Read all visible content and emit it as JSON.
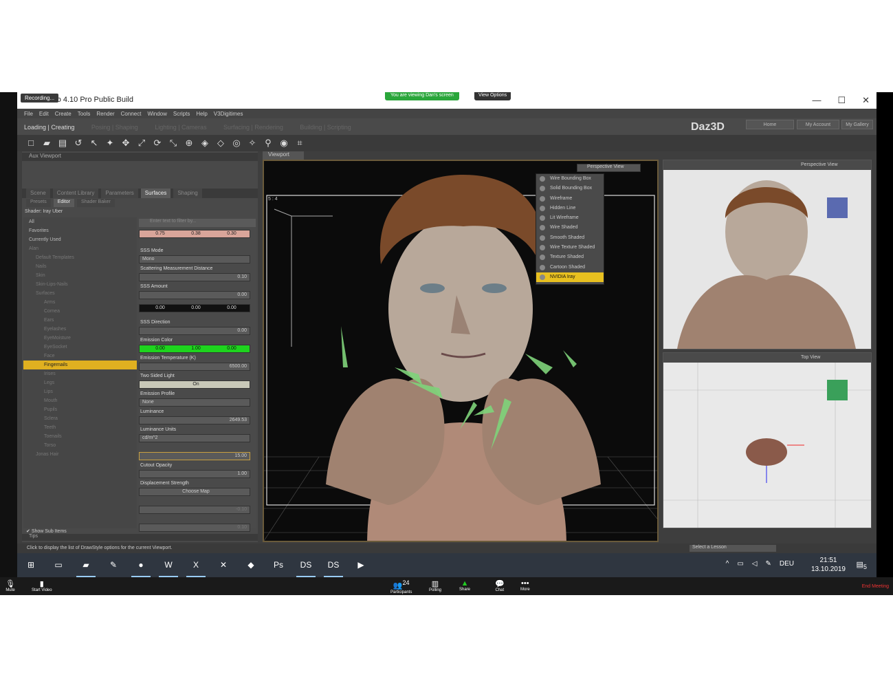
{
  "window": {
    "title": "Daz Studio 4.10 Pro Public Build",
    "recording": "Recording...",
    "share_banner": "You are viewing Dan's screen",
    "view_options": "View Options"
  },
  "menu": [
    "File",
    "Edit",
    "Create",
    "Tools",
    "Render",
    "Connect",
    "Window",
    "Scripts",
    "Help",
    "V3Digitimes"
  ],
  "room_tabs": [
    "Loading | Creating",
    "Posing | Shaping",
    "Lighting | Cameras",
    "Surfacing | Rendering",
    "Building | Scripting"
  ],
  "brand": "Daz3D",
  "top_buttons": [
    "Home",
    "My Account",
    "My Gallery"
  ],
  "aux_viewport": "Aux Viewport",
  "panel_tabs": [
    "Scene",
    "Content Library",
    "Parameters",
    "Surfaces",
    "Shaping"
  ],
  "sub_tabs": [
    "Presets",
    "Editor",
    "Shader Baker"
  ],
  "shader_label": "Shader: Iray Uber",
  "tree": [
    {
      "label": "All",
      "type": "top"
    },
    {
      "label": "Favorites",
      "type": "top"
    },
    {
      "label": "Currently Used",
      "type": "top"
    },
    {
      "label": "Alan",
      "type": "dim"
    },
    {
      "label": "Default Templates",
      "type": "dim"
    },
    {
      "label": "Nails",
      "type": "dim"
    },
    {
      "label": "Skin",
      "type": "dim"
    },
    {
      "label": "Skin-Lips-Nails",
      "type": "dim"
    },
    {
      "label": "Surfaces",
      "type": "dim"
    },
    {
      "label": "Arms",
      "type": "dim"
    },
    {
      "label": "Cornea",
      "type": "dim"
    },
    {
      "label": "Ears",
      "type": "dim"
    },
    {
      "label": "Eyelashes",
      "type": "dim"
    },
    {
      "label": "EyeMoisture",
      "type": "dim"
    },
    {
      "label": "EyeSocket",
      "type": "dim"
    },
    {
      "label": "Face",
      "type": "dim"
    },
    {
      "label": "Fingernails",
      "type": "sel"
    },
    {
      "label": "Irises",
      "type": "dim"
    },
    {
      "label": "Legs",
      "type": "dim"
    },
    {
      "label": "Lips",
      "type": "dim"
    },
    {
      "label": "Mouth",
      "type": "dim"
    },
    {
      "label": "Pupils",
      "type": "dim"
    },
    {
      "label": "Sclera",
      "type": "dim"
    },
    {
      "label": "Teeth",
      "type": "dim"
    },
    {
      "label": "Toenails",
      "type": "dim"
    },
    {
      "label": "Torso",
      "type": "dim"
    },
    {
      "label": "Jonas Hair",
      "type": "dim"
    }
  ],
  "filter_placeholder": "Enter text to filter by...",
  "props": {
    "color_vals": [
      "0.75",
      "0.38",
      "0.30"
    ],
    "sss_mode_label": "SSS Mode",
    "sss_mode_val": "Mono",
    "scatter_label": "Scattering Measurement Distance",
    "scatter_val": "0.10",
    "sss_amount_label": "SSS Amount",
    "sss_amount_val": "0.00",
    "black_vals": [
      "0.00",
      "0.00",
      "0.00"
    ],
    "sss_dir_label": "SSS Direction",
    "sss_dir_val": "0.00",
    "emis_color_label": "Emission Color",
    "emis_vals": [
      "0.00",
      "1.00",
      "0.00"
    ],
    "emis_temp_label": "Emission Temperature (K)",
    "emis_temp_val": "6500.00",
    "two_sided_label": "Two Sided Light",
    "two_sided_val": "On",
    "emis_profile_label": "Emission Profile",
    "emis_profile_val": "None",
    "lum_label": "Luminance",
    "lum_val": "2649.53",
    "lum_units_label": "Luminance Units",
    "lum_units_val": "cd/m^2",
    "lum_eff_val": "15.00",
    "cutout_label": "Cutout Opacity",
    "cutout_val": "1.00",
    "disp_label": "Displacement Strength",
    "disp_map": "Choose Map",
    "min_disp_val": "-0.10",
    "max_disp_val": "0.10"
  },
  "show_sub_items": "Show Sub Items",
  "tips": "Tips",
  "viewport_tab": "Viewport",
  "aspect": "5 : 4",
  "perspective_btn": "Perspective View",
  "drawstyles": [
    "Wire Bounding Box",
    "Solid Bounding Box",
    "Wireframe",
    "Hidden Line",
    "Lit Wireframe",
    "Wire Shaded",
    "Smooth Shaded",
    "Wire Texture Shaded",
    "Texture Shaded",
    "Cartoon Shaded",
    "NVIDIA Iray"
  ],
  "right_top_view": "Perspective View",
  "right_bottom_view": "Top View",
  "status": "Click to display the list of DrawStyle options for the current Viewport.",
  "lesson": "Select a Lesson",
  "taskbar": {
    "lang": "DEU",
    "time": "21:51",
    "date": "13.10.2019",
    "notif": "5"
  },
  "zoom": {
    "mute": "Mute",
    "video": "Start Video",
    "participants": "Participants",
    "participants_count": "24",
    "polling": "Polling",
    "share": "Share",
    "chat": "Chat",
    "more": "More",
    "end": "End Meeting"
  },
  "colors": {
    "accent": "#e8c020",
    "emission": "#1ed41e",
    "nails": "#7fd37a"
  }
}
